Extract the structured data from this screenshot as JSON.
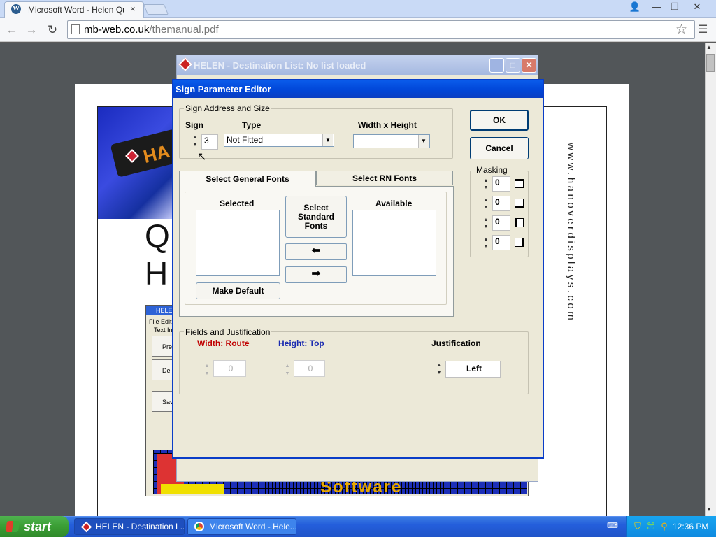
{
  "browser": {
    "tab_title": "Microsoft Word - Helen Quick",
    "tab_close": "×",
    "url_domain": "mb-web.co.uk",
    "url_path": "/themanual.pdf",
    "win_user": "👤",
    "win_min": "—",
    "win_restore": "❐",
    "win_close": "✕"
  },
  "pdf": {
    "banner_text": "HA",
    "big_q": "Q",
    "big_h": "H",
    "side_url": "www.hanoverdisplays.com",
    "mini": {
      "title": "HELE",
      "menu": "File  Edit",
      "label": "Text In",
      "btn1": "Pre",
      "btn2": "De",
      "btn3": "Sav",
      "bottom_text": "Software"
    }
  },
  "helen_window": {
    "title": "HELEN - Destination List: No list loaded",
    "minimize": "_",
    "maximize": "□",
    "close": "✕"
  },
  "dialog": {
    "title": "Sign Parameter Editor",
    "address_group": "Sign Address and Size",
    "sign_label": "Sign",
    "sign_value": "3",
    "type_label": "Type",
    "type_value": "Not Fitted",
    "wh_label": "Width x Height",
    "wh_value": "",
    "ok": "OK",
    "cancel": "Cancel",
    "tabs": {
      "general": "Select General Fonts",
      "rn": "Select RN Fonts"
    },
    "selected_label": "Selected",
    "available_label": "Available",
    "select_standard": "Select Standard Fonts",
    "make_default": "Make Default",
    "masking": {
      "label": "Masking",
      "values": [
        "0",
        "0",
        "0",
        "0"
      ]
    },
    "fields_group": "Fields and Justification",
    "width_label": "Width: Route",
    "width_value": "0",
    "height_label": "Height: Top",
    "height_value": "0",
    "justification_label": "Justification",
    "justification_value": "Left",
    "colors": {
      "width_label": "#c00000",
      "height_label": "#1a2bb0"
    }
  },
  "taskbar": {
    "start": "start",
    "task1": "HELEN - Destination L...",
    "task2": "Microsoft Word - Hele...",
    "clock": "12:36 PM"
  }
}
